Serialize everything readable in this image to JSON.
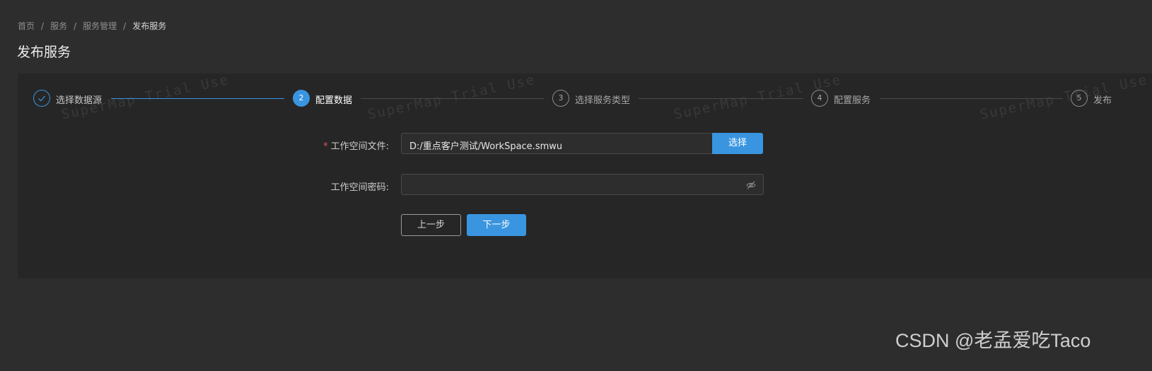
{
  "breadcrumb": {
    "items": [
      "首页",
      "服务",
      "服务管理",
      "发布服务"
    ],
    "separator": "/"
  },
  "page_title": "发布服务",
  "steps": [
    {
      "index": "✓",
      "title": "选择数据源",
      "state": "done"
    },
    {
      "index": "2",
      "title": "配置数据",
      "state": "active"
    },
    {
      "index": "3",
      "title": "选择服务类型",
      "state": "pending"
    },
    {
      "index": "4",
      "title": "配置服务",
      "state": "pending"
    },
    {
      "index": "5",
      "title": "发布",
      "state": "pending"
    }
  ],
  "watermark": "SuperMap Trial Use",
  "form": {
    "workspace_file": {
      "required_mark": "*",
      "label": "工作空间文件:",
      "value": "D:/重点客户测试/WorkSpace.smwu",
      "select_button": "选择"
    },
    "workspace_password": {
      "label": "工作空间密码:",
      "value": ""
    }
  },
  "buttons": {
    "prev": "上一步",
    "next": "下一步"
  },
  "corner_watermark": "CSDN @老孟爱吃Taco",
  "colors": {
    "accent": "#3a95e0",
    "background": "#2d2d2d",
    "panel": "#262626",
    "required": "#e05353"
  }
}
